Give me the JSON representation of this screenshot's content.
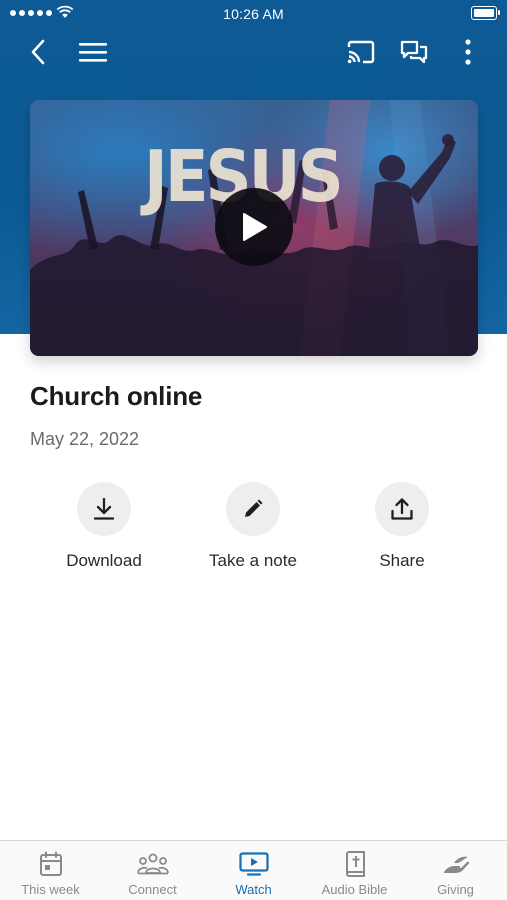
{
  "status_bar": {
    "time": "10:26 AM"
  },
  "colors": {
    "header": "#0d5a95",
    "accent": "#1570b8",
    "inactive": "#8a8a8a"
  },
  "nav": {
    "back_icon": "chevron-left-icon",
    "menu_icon": "hamburger-menu-icon",
    "cast_icon": "cast-icon",
    "chat_icon": "chat-bubbles-icon",
    "more_icon": "more-vertical-icon"
  },
  "video": {
    "thumbnail_text": "JESUS",
    "play_icon": "play-icon"
  },
  "sermon": {
    "title": "Church online",
    "date": "May 22, 2022"
  },
  "actions": [
    {
      "label": "Download",
      "icon": "download-icon"
    },
    {
      "label": "Take a note",
      "icon": "pencil-icon"
    },
    {
      "label": "Share",
      "icon": "share-upload-icon"
    }
  ],
  "tabs": [
    {
      "label": "This week",
      "icon": "calendar-icon",
      "active": false
    },
    {
      "label": "Connect",
      "icon": "people-icon",
      "active": false
    },
    {
      "label": "Watch",
      "icon": "tv-play-icon",
      "active": true
    },
    {
      "label": "Audio Bible",
      "icon": "bible-icon",
      "active": false
    },
    {
      "label": "Giving",
      "icon": "giving-hand-icon",
      "active": false
    }
  ]
}
